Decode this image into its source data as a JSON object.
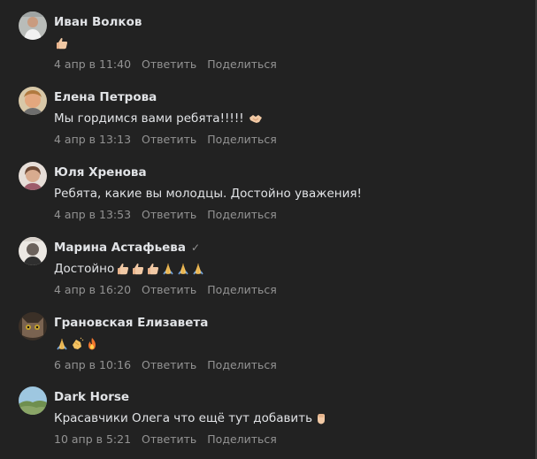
{
  "actions": {
    "reply_label": "Ответить",
    "share_label": "Поделиться"
  },
  "colors": {
    "background": "#222222",
    "text": "#e1e3e6",
    "secondary_text": "#939393"
  },
  "comments": [
    {
      "author": "Иван Волков",
      "text": "",
      "emojis": [
        "thumbs-up"
      ],
      "date": "4 апр в 11:40"
    },
    {
      "author": "Елена Петрова",
      "text": "Мы гордимся вами ребята!!!!!",
      "emojis": [
        "handshake"
      ],
      "date": "4 апр в 13:13"
    },
    {
      "author": "Юля Хренова",
      "text": "Ребята, какие вы молодцы. Достойно уважения!",
      "emojis": [],
      "date": "4 апр в 13:53"
    },
    {
      "author": "Марина Астафьева",
      "verified_icon": "✓",
      "text": "Достойно",
      "emojis": [
        "thumbs-up",
        "thumbs-up",
        "thumbs-up",
        "folded-hands",
        "folded-hands",
        "folded-hands"
      ],
      "date": "4 апр в 16:20"
    },
    {
      "author": "Грановская Елизавета",
      "text": "",
      "emojis": [
        "folded-hands",
        "clapping-hands",
        "fire"
      ],
      "date": "6 апр в 10:16"
    },
    {
      "author": "Dark Horse",
      "text": "Красавчики Олега что ещё тут добавить",
      "emojis": [
        "raised-fist"
      ],
      "date": "10 апр в 5:21"
    }
  ]
}
